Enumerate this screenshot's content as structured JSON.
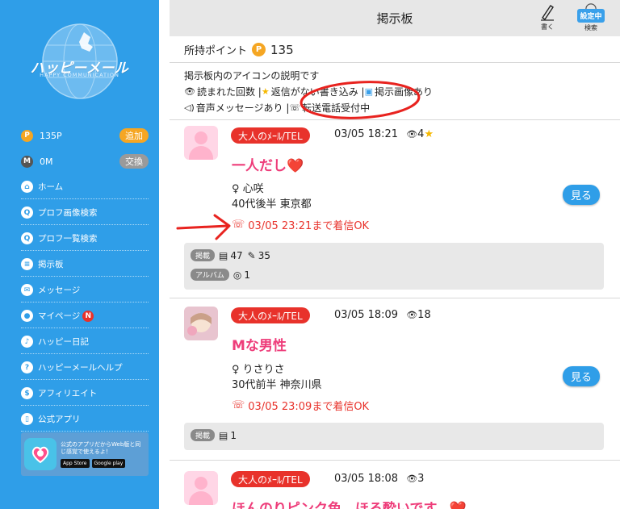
{
  "sidebar": {
    "logo_text": "ハッピーメール",
    "logo_sub": "HAPPY COMMUNICATION",
    "points_value": "135P",
    "points_button": "追加",
    "money_value": "0M",
    "money_button": "交換",
    "nav": [
      {
        "label": "ホーム",
        "icon": "home-icon",
        "glyph": "⌂"
      },
      {
        "label": "プロフ画像検索",
        "icon": "search-icon",
        "glyph": "Q"
      },
      {
        "label": "プロフ一覧検索",
        "icon": "search-icon",
        "glyph": "Q"
      },
      {
        "label": "掲示板",
        "icon": "board-icon",
        "glyph": "≡"
      },
      {
        "label": "メッセージ",
        "icon": "mail-icon",
        "glyph": "✉"
      },
      {
        "label": "マイページ",
        "icon": "user-icon",
        "glyph": "●",
        "badge": "N"
      },
      {
        "label": "ハッピー日記",
        "icon": "music-note-icon",
        "glyph": "♪"
      },
      {
        "label": "ハッピーメールヘルプ",
        "icon": "help-icon",
        "glyph": "?"
      },
      {
        "label": "アフィリエイト",
        "icon": "dollar-icon",
        "glyph": "$"
      },
      {
        "label": "公式アプリ",
        "icon": "phone-icon",
        "glyph": "▯"
      }
    ],
    "app_banner": {
      "text": "公式のアプリだからWeb版と同じ感覚で使えるよ！",
      "app_store": "App Store",
      "google_play": "Google play"
    }
  },
  "header": {
    "title": "掲示板",
    "write_label": "書く",
    "setting_badge": "設定中",
    "search_label": "検索"
  },
  "points": {
    "label": "所持ポイント",
    "coin": "P",
    "value": "135"
  },
  "legend": {
    "line1": "掲示板内のアイコンの説明です",
    "line2": "読まれた回数 | ",
    "line2b": "返信がない書き込み | ",
    "line2c": "掲示画像あり",
    "line3": "音声メッセージあり | ",
    "line3b": "転送電話受付中"
  },
  "posts": [
    {
      "category": "大人のﾒｰﾙ/TEL",
      "time": "03/05 18:21",
      "views": "4",
      "star": true,
      "title": "一人だし❤️",
      "user_name": "♀ 心咲",
      "user_info": "40代後半 東京都",
      "call": "03/05 23:21まで着信OK",
      "view_button": "見る",
      "stats_label": "掲載",
      "stats_posts": "47",
      "stats_edits": "35",
      "album_label": "アルバム",
      "album_count": "1"
    },
    {
      "category": "大人のﾒｰﾙ/TEL",
      "time": "03/05 18:09",
      "views": "18",
      "title": "Mな男性",
      "user_name": "♀ りさりさ",
      "user_info": "30代前半 神奈川県",
      "call": "03/05 23:09まで着信OK",
      "view_button": "見る",
      "stats_label": "掲載",
      "stats_posts": "1"
    },
    {
      "category": "大人のﾒｰﾙ/TEL",
      "time": "03/05 18:08",
      "views": "3",
      "title": "ほんのりピンク色、ほろ酔いです。❤️"
    }
  ],
  "colors": {
    "sidebar": "#2f9ee8",
    "accent_red": "#e8322b",
    "title_pink": "#ee3d7a",
    "coin": "#f5a623"
  }
}
